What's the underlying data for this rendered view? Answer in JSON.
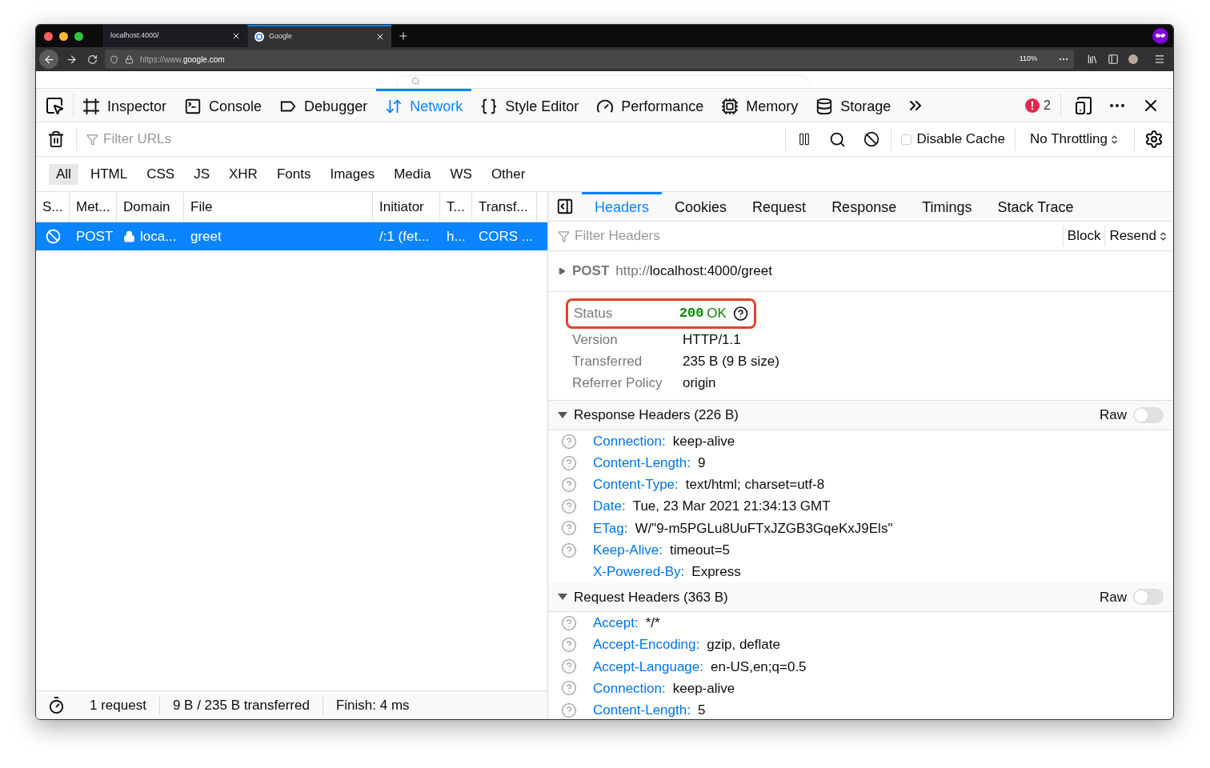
{
  "browser": {
    "tabs": [
      {
        "title": "localhost:4000/",
        "selected": false,
        "favicon": false
      },
      {
        "title": "Google",
        "selected": true,
        "favicon": true
      }
    ],
    "url": {
      "scheme": "https://www.",
      "host": "google.com"
    },
    "zoom": "110%"
  },
  "devtools": {
    "tools": [
      {
        "label": "Inspector",
        "kind": "inspector",
        "selected": false
      },
      {
        "label": "Console",
        "kind": "console",
        "selected": false
      },
      {
        "label": "Debugger",
        "kind": "debugger",
        "selected": false
      },
      {
        "label": "Network",
        "kind": "network",
        "selected": true
      },
      {
        "label": "Style Editor",
        "kind": "style",
        "selected": false
      },
      {
        "label": "Performance",
        "kind": "performance",
        "selected": false
      },
      {
        "label": "Memory",
        "kind": "memory",
        "selected": false
      },
      {
        "label": "Storage",
        "kind": "storage",
        "selected": false
      }
    ],
    "error_count": "2"
  },
  "network": {
    "filter": {
      "placeholder": "Filter URLs"
    },
    "disable_cache": {
      "label": "Disable Cache",
      "checked": false
    },
    "throttling": "No Throttling",
    "type_filters": [
      {
        "label": "All",
        "selected": true
      },
      {
        "label": "HTML",
        "selected": false
      },
      {
        "label": "CSS",
        "selected": false
      },
      {
        "label": "JS",
        "selected": false
      },
      {
        "label": "XHR",
        "selected": false
      },
      {
        "label": "Fonts",
        "selected": false
      },
      {
        "label": "Images",
        "selected": false
      },
      {
        "label": "Media",
        "selected": false
      },
      {
        "label": "WS",
        "selected": false
      },
      {
        "label": "Other",
        "selected": false
      }
    ],
    "columns": [
      "S...",
      "Met...",
      "Domain",
      "File",
      "Initiator",
      "T...",
      "Transf..."
    ],
    "rows": [
      {
        "method": "POST",
        "domain": "loca...",
        "file": "greet",
        "initiator": "/:1 (fet...",
        "type": "h...",
        "transferred": "CORS ...",
        "selected": true,
        "blocked": true,
        "secure": true
      }
    ],
    "status_bar": [
      "1 request",
      "9 B / 235 B transferred",
      "Finish: 4 ms"
    ]
  },
  "details": {
    "tabs": [
      {
        "label": "Headers",
        "selected": true
      },
      {
        "label": "Cookies",
        "selected": false
      },
      {
        "label": "Request",
        "selected": false
      },
      {
        "label": "Response",
        "selected": false
      },
      {
        "label": "Timings",
        "selected": false
      },
      {
        "label": "Stack Trace",
        "selected": false
      }
    ],
    "filter": {
      "placeholder": "Filter Headers"
    },
    "block": "Block",
    "resend": "Resend",
    "request": {
      "method": "POST",
      "scheme": "http://",
      "address": "localhost:4000/greet",
      "expanded": false
    },
    "status": {
      "label": "Status",
      "code": "200",
      "text": "OK",
      "highlighted": true
    },
    "summary": [
      {
        "label": "Version",
        "value": "HTTP/1.1"
      },
      {
        "label": "Transferred",
        "value": "235 B (9 B size)"
      },
      {
        "label": "Referrer Policy",
        "value": "origin"
      }
    ],
    "sections": [
      {
        "title": "Response Headers (226 B)",
        "expanded": true,
        "raw_label": "Raw",
        "raw": false,
        "items": [
          {
            "name": "Connection:",
            "value": "keep-alive",
            "help": true
          },
          {
            "name": "Content-Length:",
            "value": "9",
            "help": true
          },
          {
            "name": "Content-Type:",
            "value": "text/html; charset=utf-8",
            "help": true
          },
          {
            "name": "Date:",
            "value": "Tue, 23 Mar 2021 21:34:13 GMT",
            "help": true
          },
          {
            "name": "ETag:",
            "value": "W/\"9-m5PGLu8UuFTxJZGB3GqeKxJ9Els\"",
            "help": true
          },
          {
            "name": "Keep-Alive:",
            "value": "timeout=5",
            "help": true
          },
          {
            "name": "X-Powered-By:",
            "value": "Express",
            "help": false
          }
        ]
      },
      {
        "title": "Request Headers (363 B)",
        "expanded": true,
        "raw_label": "Raw",
        "raw": false,
        "items": [
          {
            "name": "Accept:",
            "value": "*/*",
            "help": true
          },
          {
            "name": "Accept-Encoding:",
            "value": "gzip, deflate",
            "help": true
          },
          {
            "name": "Accept-Language:",
            "value": "en-US,en;q=0.5",
            "help": true
          },
          {
            "name": "Connection:",
            "value": "keep-alive",
            "help": true
          },
          {
            "name": "Content-Length:",
            "value": "5",
            "help": true
          }
        ]
      }
    ]
  }
}
